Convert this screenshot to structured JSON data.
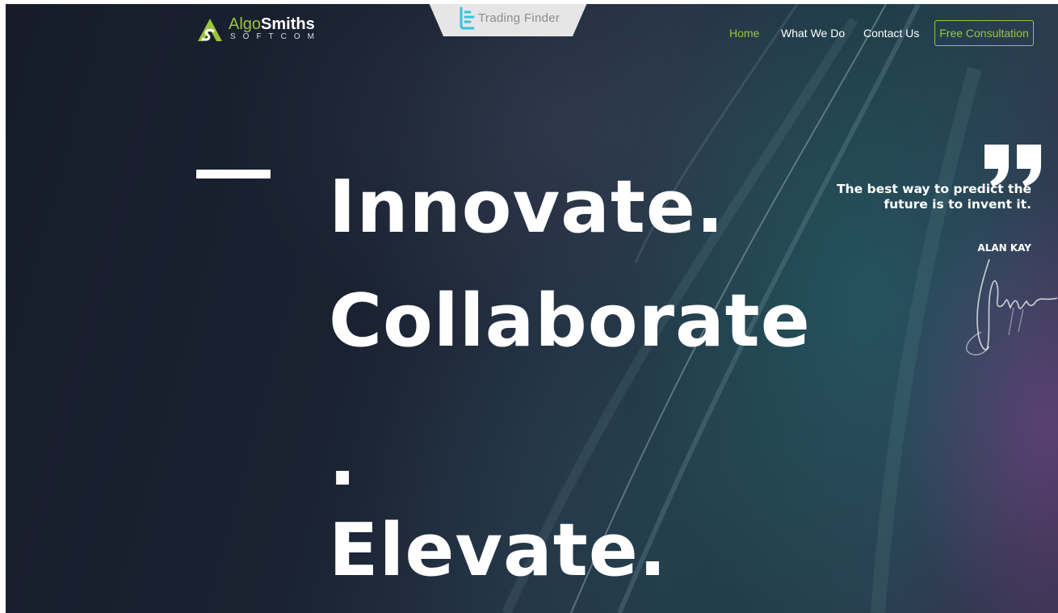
{
  "header": {
    "logo": {
      "name_part1": "Algo",
      "name_part2": "Smiths",
      "sub": "SOFTCOM",
      "accent_color": "#9bc53d"
    },
    "watermark": {
      "label": "Trading Finder",
      "icon": "trading-finder-icon"
    },
    "nav": [
      {
        "label": "Home",
        "active": true
      },
      {
        "label": "What We Do",
        "active": false
      },
      {
        "label": "Contact Us",
        "active": false
      }
    ],
    "cta_label": "Free Consultation"
  },
  "hero": {
    "lines": [
      "Innovate.",
      "Collaborate",
      ".",
      "Elevate."
    ]
  },
  "quote": {
    "text": "The best way to predict the future is to invent it.",
    "author": "ALAN KAY",
    "icon": "quote-icon"
  },
  "colors": {
    "accent": "#9bc53d",
    "background": "#1a2231",
    "text": "#ffffff"
  }
}
